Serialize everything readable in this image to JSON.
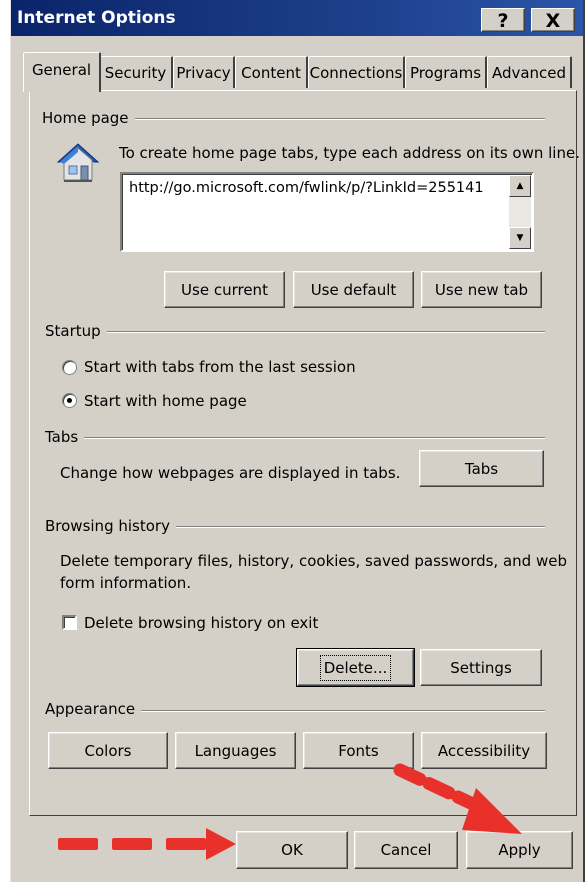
{
  "window": {
    "title": "Internet Options",
    "help_btn": "?",
    "close_btn": "X"
  },
  "tabs": [
    "General",
    "Security",
    "Privacy",
    "Content",
    "Connections",
    "Programs",
    "Advanced"
  ],
  "home_page": {
    "heading": "Home page",
    "instruction": "To create home page tabs, type each address on its own line.",
    "url": "http://go.microsoft.com/fwlink/p/?LinkId=255141",
    "use_current": "Use current",
    "use_default": "Use default",
    "use_new_tab": "Use new tab"
  },
  "startup": {
    "heading": "Startup",
    "option_last_session": "Start with tabs from the last session",
    "option_home_page": "Start with home page",
    "selected": "option_home_page"
  },
  "tabs_group": {
    "heading": "Tabs",
    "description": "Change how webpages are displayed in tabs.",
    "tabs_button": "Tabs"
  },
  "browsing_history": {
    "heading": "Browsing history",
    "description_line1": "Delete temporary files, history, cookies, saved passwords, and web",
    "description_line2": "form information.",
    "delete_on_exit": "Delete browsing history on exit",
    "delete_on_exit_checked": false,
    "delete_button": "Delete...",
    "settings_button": "Settings"
  },
  "appearance": {
    "heading": "Appearance",
    "colors": "Colors",
    "languages": "Languages",
    "fonts": "Fonts",
    "accessibility": "Accessibility"
  },
  "footer": {
    "ok": "OK",
    "cancel": "Cancel",
    "apply": "Apply"
  },
  "colors": {
    "annotation_arrow": "#e8312a",
    "titlebar": "#0a246a",
    "dialog_bg": "#d4d0c8"
  }
}
